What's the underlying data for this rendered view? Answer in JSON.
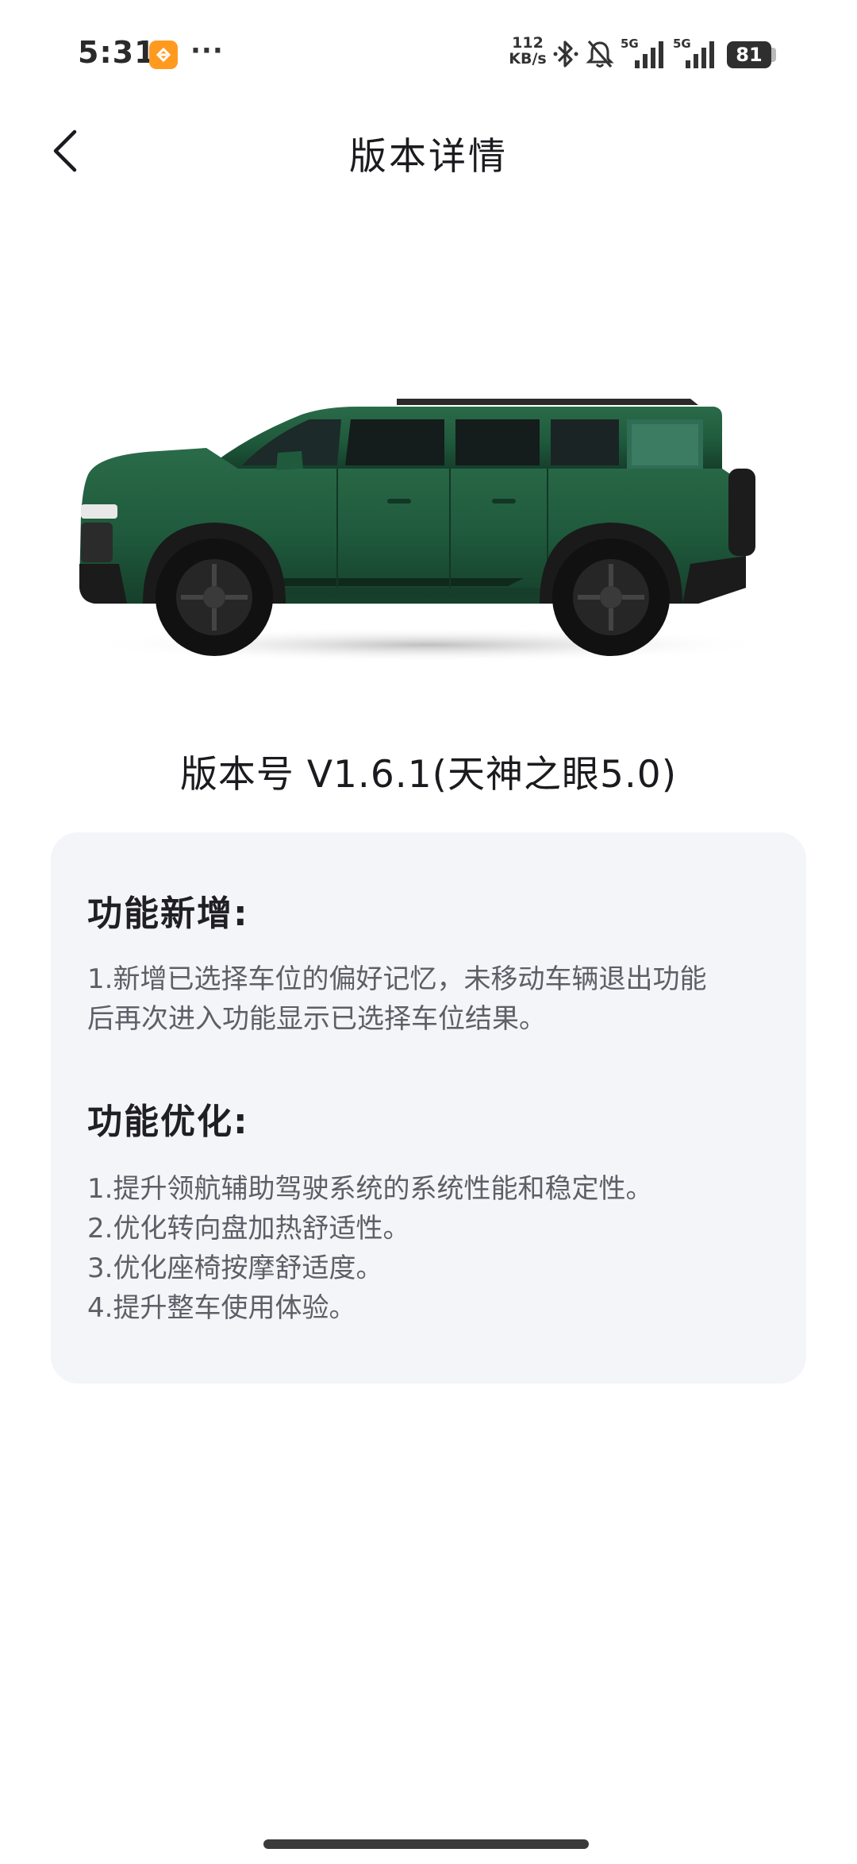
{
  "status_bar": {
    "time": "5:31",
    "more": "···",
    "net_speed_value": "112",
    "net_speed_unit": "KB/s",
    "sim1_label": "5G",
    "sim2_label": "5G",
    "battery": "81"
  },
  "header": {
    "title": "版本详情"
  },
  "car": {
    "color": "#1f5a3c"
  },
  "version": {
    "label": "版本号 V1.6.1(天神之眼5.0)"
  },
  "notes": {
    "added": {
      "title": "功能新增:",
      "lines": [
        "1.新增已选择车位的偏好记忆，未移动车辆退出功能",
        "后再次进入功能显示已选择车位结果。"
      ]
    },
    "optimized": {
      "title": "功能优化:",
      "lines": [
        "1.提升领航辅助驾驶系统的系统性能和稳定性。",
        "2.优化转向盘加热舒适性。",
        "3.优化座椅按摩舒适度。",
        "4.提升整车使用体验。"
      ]
    }
  },
  "colors": {
    "card_background": "#f4f5f9",
    "body_text": "#5d5f66",
    "title_text": "#1b1b1f"
  }
}
